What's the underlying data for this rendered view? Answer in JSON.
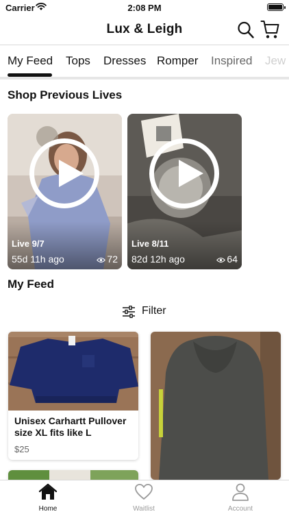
{
  "status_bar": {
    "carrier": "Carrier",
    "time": "2:08 PM"
  },
  "header": {
    "title": "Lux & Leigh",
    "search_icon": "search-icon",
    "cart_icon": "cart-icon"
  },
  "tabs": [
    {
      "label": "My Feed",
      "selected": true
    },
    {
      "label": "Tops"
    },
    {
      "label": "Dresses"
    },
    {
      "label": "Romper"
    },
    {
      "label": "Inspired"
    },
    {
      "label": "Jew"
    }
  ],
  "previous_lives": {
    "title": "Shop Previous Lives",
    "items": [
      {
        "label": "Live 9/7",
        "ago": "55d 11h ago",
        "views": "72"
      },
      {
        "label": "Live 8/11",
        "ago": "82d 12h ago",
        "views": "64"
      }
    ]
  },
  "feed": {
    "title": "My Feed",
    "filter_label": "Filter",
    "products": [
      {
        "name": "Unisex Carhartt Pullover size XL fits like L",
        "price": "$25"
      }
    ]
  },
  "tab_bar": [
    {
      "label": "Home",
      "icon": "home-icon",
      "active": true
    },
    {
      "label": "Waitlist",
      "icon": "heart-icon",
      "active": false
    },
    {
      "label": "Account",
      "icon": "person-icon",
      "active": false
    }
  ],
  "colors": {
    "active": "#111111",
    "inactive": "#9a9a9a",
    "divider": "#e6e6e6"
  }
}
